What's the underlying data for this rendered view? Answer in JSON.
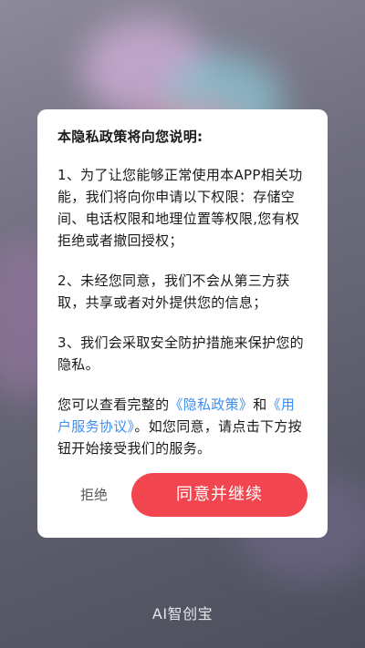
{
  "dialog": {
    "title": "本隐私政策将向您说明:",
    "para1": "1、为了让您能够正常使用本APP相关功能，我们将向你申请以下权限：存储空间、电话权限和地理位置等权限,您有权拒绝或者撤回授权；",
    "para2": "2、未经您同意，我们不会从第三方获取，共享或者对外提供您的信息；",
    "para3": "3、我们会采取安全防护措施来保护您的隐私。",
    "para4": {
      "prefix": "您可以查看完整的",
      "privacy_link": "《隐私政策》",
      "and": "和",
      "agreement_link": "《用户服务协议》",
      "suffix": "。如您同意，请点击下方按钮开始接受我们的服务。"
    },
    "reject_label": "拒绝",
    "agree_label": "同意并继续"
  },
  "app": {
    "name": "AI智创宝"
  },
  "colors": {
    "accent": "#f1464f",
    "link": "#3d8ef0"
  }
}
